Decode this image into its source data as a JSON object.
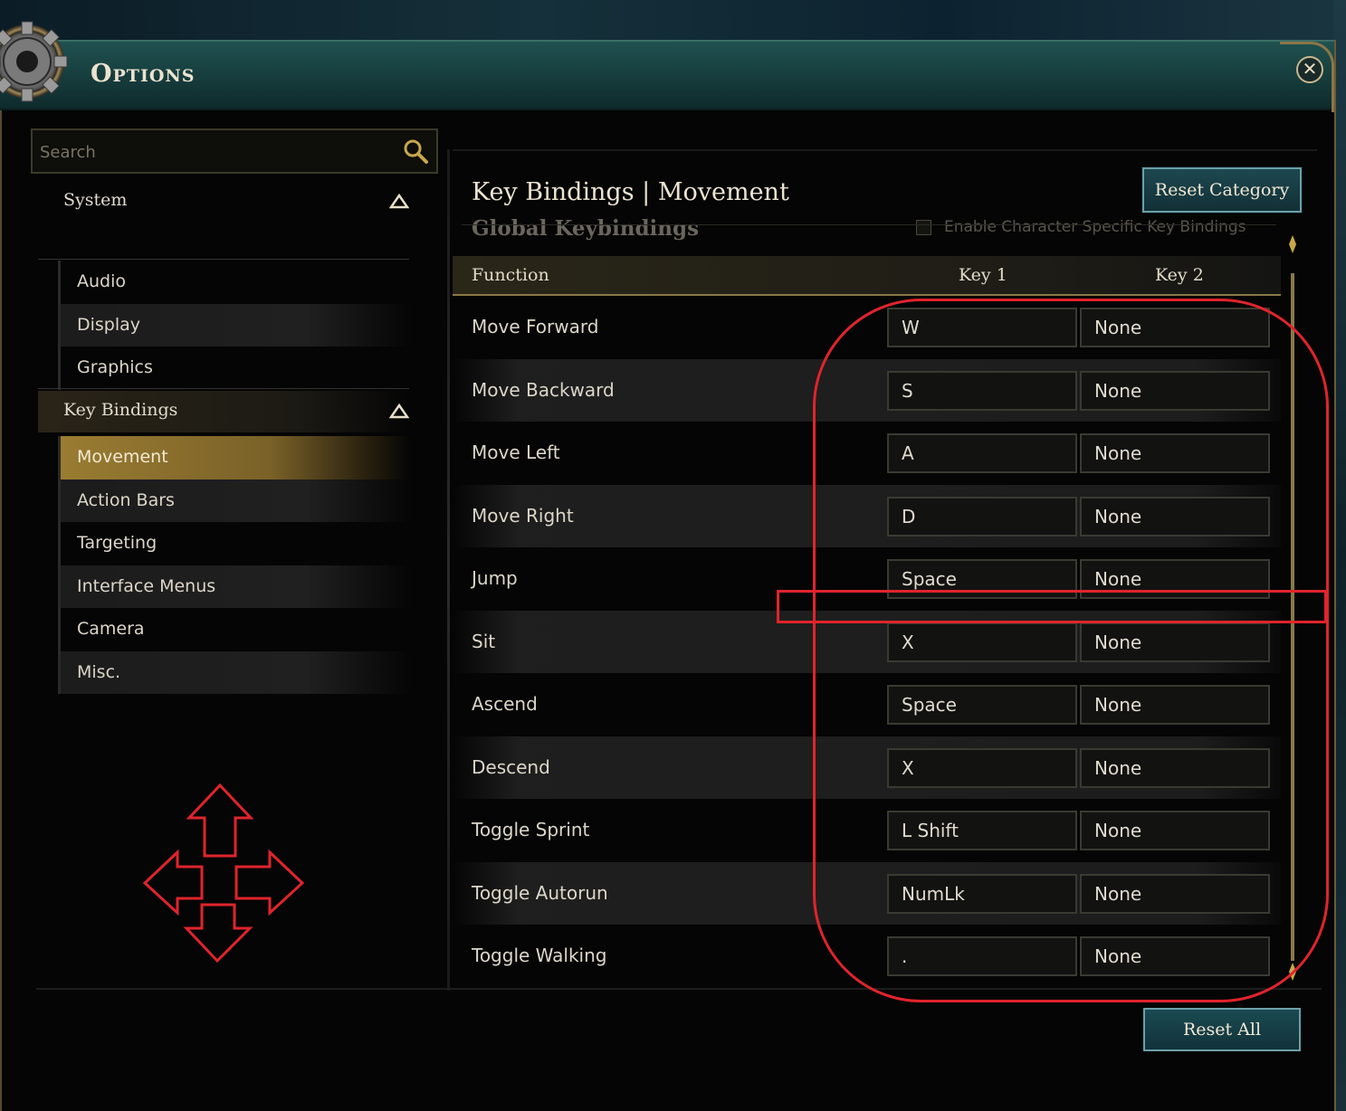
{
  "window": {
    "title": "Options",
    "close_glyph": "✕"
  },
  "sidebar": {
    "search_placeholder": "Search",
    "categories": [
      {
        "label": "System",
        "items": [
          "Audio",
          "Display",
          "Graphics"
        ]
      },
      {
        "label": "Key Bindings",
        "items": [
          "Movement",
          "Action Bars",
          "Targeting",
          "Interface Menus",
          "Camera",
          "Misc."
        ],
        "active_item": "Movement"
      }
    ]
  },
  "main": {
    "title": "Key Bindings | Movement",
    "reset_category_label": "Reset Category",
    "global_keybindings_label": "Global Keybindings",
    "enable_character_label": "Enable Character Specific Key Bindings",
    "columns": [
      "Function",
      "Key 1",
      "Key 2"
    ],
    "rows": [
      {
        "function": "Move Forward",
        "key1": "W",
        "key2": "None"
      },
      {
        "function": "Move Backward",
        "key1": "S",
        "key2": "None"
      },
      {
        "function": "Move Left",
        "key1": "A",
        "key2": "None"
      },
      {
        "function": "Move Right",
        "key1": "D",
        "key2": "None"
      },
      {
        "function": "Jump",
        "key1": "Space",
        "key2": "None"
      },
      {
        "function": "Sit",
        "key1": "X",
        "key2": "None"
      },
      {
        "function": "Ascend",
        "key1": "Space",
        "key2": "None"
      },
      {
        "function": "Descend",
        "key1": "X",
        "key2": "None"
      },
      {
        "function": "Toggle Sprint",
        "key1": "L Shift",
        "key2": "None"
      },
      {
        "function": "Toggle Autorun",
        "key1": "NumLk",
        "key2": "None"
      },
      {
        "function": "Toggle Walking",
        "key1": ".",
        "key2": "None"
      }
    ]
  },
  "footer": {
    "reset_all_label": "Reset All"
  },
  "colors": {
    "accent_gold": "#9a7c32",
    "button_teal": "#1d4850",
    "annotation_red": "#e0242c"
  }
}
